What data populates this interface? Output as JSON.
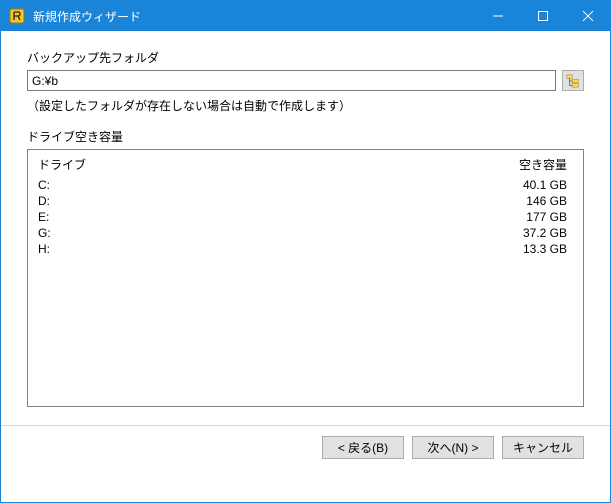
{
  "window": {
    "title": "新規作成ウィザード"
  },
  "body": {
    "folder_label": "バックアップ先フォルダ",
    "folder_path": "G:¥b",
    "hint_text": "（設定したフォルダが存在しない場合は自動で作成します）",
    "drive_section_label": "ドライブ空き容量",
    "drive_table": {
      "header_drive": "ドライブ",
      "header_free": "空き容量",
      "rows": [
        {
          "drive": "C:",
          "free": "40.1 GB"
        },
        {
          "drive": "D:",
          "free": "146 GB"
        },
        {
          "drive": "E:",
          "free": "177 GB"
        },
        {
          "drive": "G:",
          "free": "37.2 GB"
        },
        {
          "drive": "H:",
          "free": "13.3 GB"
        }
      ]
    }
  },
  "buttons": {
    "back": "< 戻る(B)",
    "next": "次へ(N) >",
    "cancel": "キャンセル"
  }
}
